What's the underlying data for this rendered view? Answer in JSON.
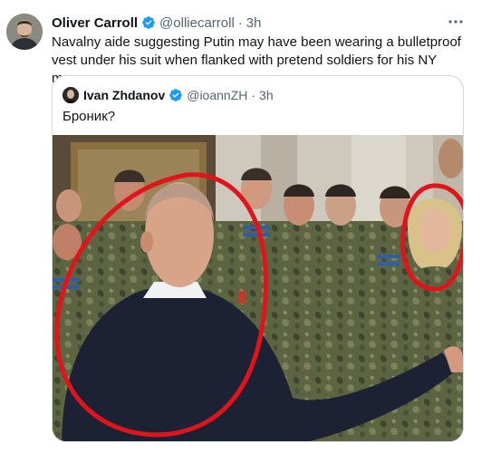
{
  "tweet": {
    "author_name": "Oliver Carroll",
    "author_handle": "@olliecarroll",
    "separator": "·",
    "time": "3h",
    "text": "Navalny aide suggesting Putin may have been wearing a bulletproof vest under his suit when flanked with pretend soldiers for his NY message"
  },
  "quote": {
    "author_name": "Ivan Zhdanov",
    "author_handle": "@ioannZH",
    "separator": "·",
    "time": "3h",
    "text": "Броник?"
  },
  "colors": {
    "verified_blue": "#1d9bf0",
    "annotation_red": "#e0141b",
    "secondary_text": "#536471"
  },
  "icons": {
    "verified": "verified-badge-icon",
    "more": "more-dots-icon"
  }
}
